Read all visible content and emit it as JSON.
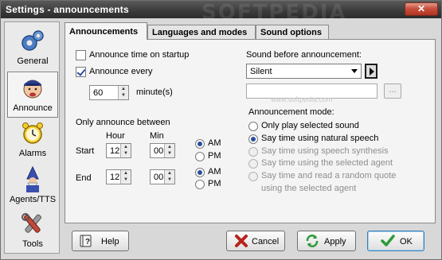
{
  "window": {
    "title": "Settings - announcements",
    "close_glyph": "✕",
    "watermark": "SOFTPEDIA"
  },
  "sidebar": {
    "items": [
      {
        "label": "General",
        "icon": "gears-icon"
      },
      {
        "label": "Announce",
        "icon": "announcer-icon",
        "active": true
      },
      {
        "label": "Alarms",
        "icon": "alarm-clock-icon"
      },
      {
        "label": "Agents/TTS",
        "icon": "wizard-icon"
      },
      {
        "label": "Tools",
        "icon": "tools-icon"
      }
    ]
  },
  "tabs": [
    {
      "label": "Announcements",
      "active": true
    },
    {
      "label": "Languages and modes"
    },
    {
      "label": "Sound options"
    }
  ],
  "announce": {
    "startup_label": "Announce time on startup",
    "startup_checked": false,
    "every_label": "Announce every",
    "every_checked": true,
    "interval_value": "60",
    "interval_unit": "minute(s)"
  },
  "between": {
    "heading": "Only announce between",
    "hour_header": "Hour",
    "min_header": "Min",
    "start_label": "Start",
    "start_hour": "12",
    "start_min": "00",
    "start_am_label": "AM",
    "start_pm_label": "PM",
    "start_period": "AM",
    "end_label": "End",
    "end_hour": "12",
    "end_min": "00",
    "end_am_label": "AM",
    "end_pm_label": "PM",
    "end_period": "AM"
  },
  "sound": {
    "label": "Sound before announcement:",
    "selected": "Silent",
    "path_value": "",
    "watermark": "www.softpedia.com",
    "browse_label": "..."
  },
  "mode": {
    "heading": "Announcement mode:",
    "options": [
      {
        "label": "Only play selected sound",
        "selected": false,
        "enabled": true
      },
      {
        "label": "Say time using natural speech",
        "selected": true,
        "enabled": true
      },
      {
        "label": "Say time using speech synthesis",
        "selected": false,
        "enabled": false
      },
      {
        "label": "Say time using the selected agent",
        "selected": false,
        "enabled": false
      },
      {
        "label": "Say time and read a random quote",
        "selected": false,
        "enabled": false
      }
    ],
    "last_option_sub": "using the selected agent"
  },
  "footer": {
    "help_label": "Help",
    "cancel_label": "Cancel",
    "apply_label": "Apply",
    "ok_label": "OK"
  },
  "colors": {
    "accent": "#2a4e9e",
    "title_bar": "#3a3a3a",
    "close": "#c9503d",
    "cancel_x": "#b8231a",
    "apply": "#2f9a3a",
    "ok_check": "#2f9a3a"
  }
}
